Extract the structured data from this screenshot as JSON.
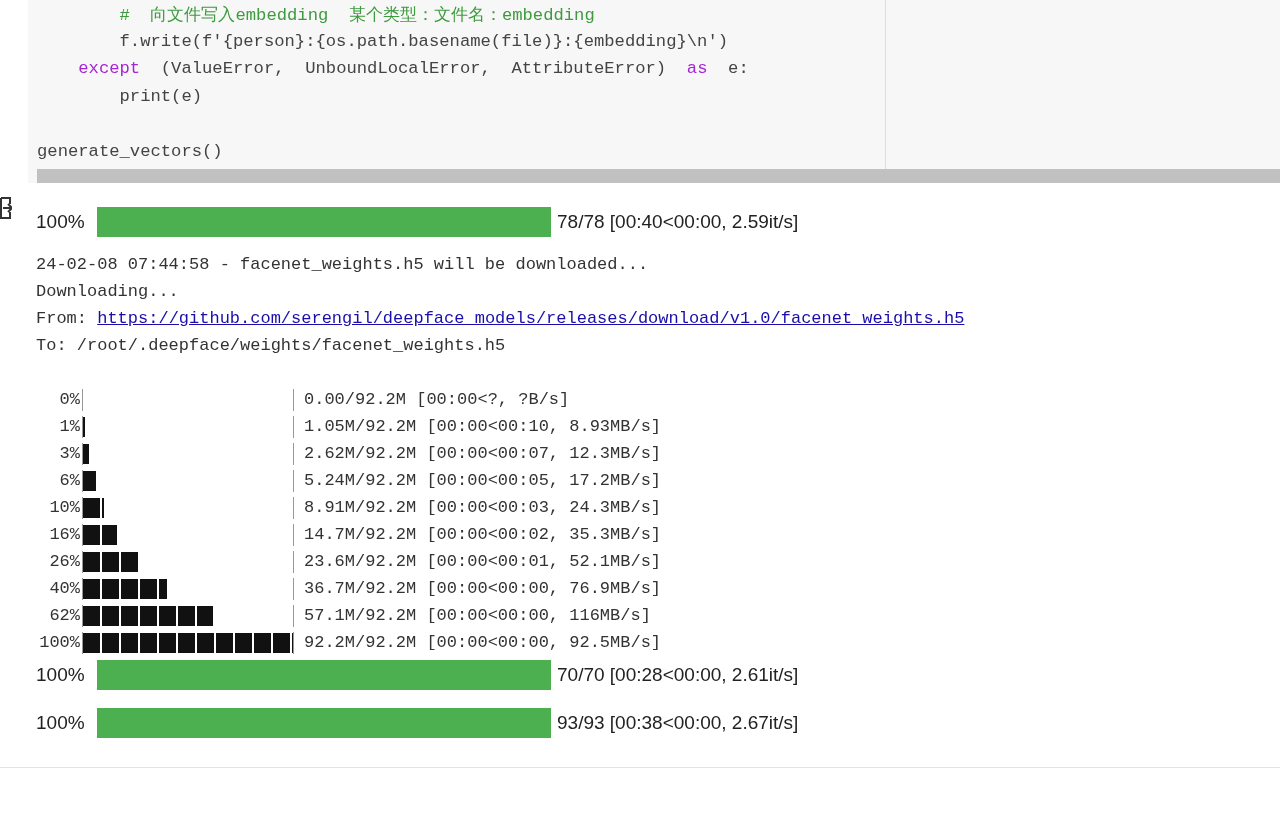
{
  "code_lines": [
    {
      "kind": "code",
      "tokens": [
        {
          "kind": "comment",
          "text": "        #  向文件写入embedding  某个类型：文件名：embedding"
        }
      ]
    },
    {
      "kind": "code",
      "tokens": [
        {
          "kind": "plain",
          "text": "        f.write(f'{person}:{os.path.basename(file)}:{embedding}\\n')"
        }
      ]
    },
    {
      "kind": "code",
      "tokens": [
        {
          "kind": "keyword",
          "text": "    except"
        },
        {
          "kind": "plain",
          "text": "  (ValueError,  UnboundLocalError,  AttributeError)"
        },
        {
          "kind": "keyword",
          "text": "  as"
        },
        {
          "kind": "plain",
          "text": "  e:"
        }
      ]
    },
    {
      "kind": "code",
      "tokens": [
        {
          "kind": "plain",
          "text": "        print(e)"
        }
      ]
    },
    {
      "kind": "blank"
    },
    {
      "kind": "code",
      "tokens": [
        {
          "kind": "plain",
          "text": "generate_vectors()"
        }
      ]
    }
  ],
  "output": [
    {
      "kind": "widget",
      "percent": "100%",
      "level": 1,
      "stats": "78/78 [00:40<00:00, 2.59it/s]"
    },
    {
      "kind": "log",
      "text": "24-02-08 07:44:58 - facenet_weights.h5 will be downloaded..."
    },
    {
      "kind": "log",
      "text": "Downloading..."
    },
    {
      "kind": "link",
      "label": "From: ",
      "url": "https://github.com/serengil/deepface_models/releases/download/v1.0/facenet_weights.h5"
    },
    {
      "kind": "log",
      "text": "To: /root/.deepface/weights/facenet_weights.h5"
    },
    {
      "kind": "spacer"
    },
    {
      "kind": "textbar",
      "percent": "0%",
      "level": 0,
      "stats": "0.00/92.2M [00:00<?, ?B/s]"
    },
    {
      "kind": "textbar",
      "percent": "1%",
      "level": 0.01,
      "stats": "1.05M/92.2M [00:00<00:10, 8.93MB/s]"
    },
    {
      "kind": "textbar",
      "percent": "3%",
      "level": 0.03,
      "stats": "2.62M/92.2M [00:00<00:07, 12.3MB/s]"
    },
    {
      "kind": "textbar",
      "percent": "6%",
      "level": 0.06,
      "stats": "5.24M/92.2M [00:00<00:05, 17.2MB/s]"
    },
    {
      "kind": "textbar",
      "percent": "10%",
      "level": 0.1,
      "stats": "8.91M/92.2M [00:00<00:03, 24.3MB/s]"
    },
    {
      "kind": "textbar",
      "percent": "16%",
      "level": 0.16,
      "stats": "14.7M/92.2M [00:00<00:02, 35.3MB/s]"
    },
    {
      "kind": "textbar",
      "percent": "26%",
      "level": 0.26,
      "stats": "23.6M/92.2M [00:00<00:01, 52.1MB/s]"
    },
    {
      "kind": "textbar",
      "percent": "40%",
      "level": 0.4,
      "stats": "36.7M/92.2M [00:00<00:00, 76.9MB/s]"
    },
    {
      "kind": "textbar",
      "percent": "62%",
      "level": 0.62,
      "stats": "57.1M/92.2M [00:00<00:00, 116MB/s]"
    },
    {
      "kind": "textbar",
      "percent": "100%",
      "level": 1,
      "stats": "92.2M/92.2M [00:00<00:00, 92.5MB/s]"
    },
    {
      "kind": "widget",
      "percent": "100%",
      "level": 1,
      "stats": "70/70 [00:28<00:00, 2.61it/s]"
    },
    {
      "kind": "widget",
      "percent": "100%",
      "level": 1,
      "stats": "93/93 [00:38<00:00, 2.67it/s]"
    }
  ]
}
